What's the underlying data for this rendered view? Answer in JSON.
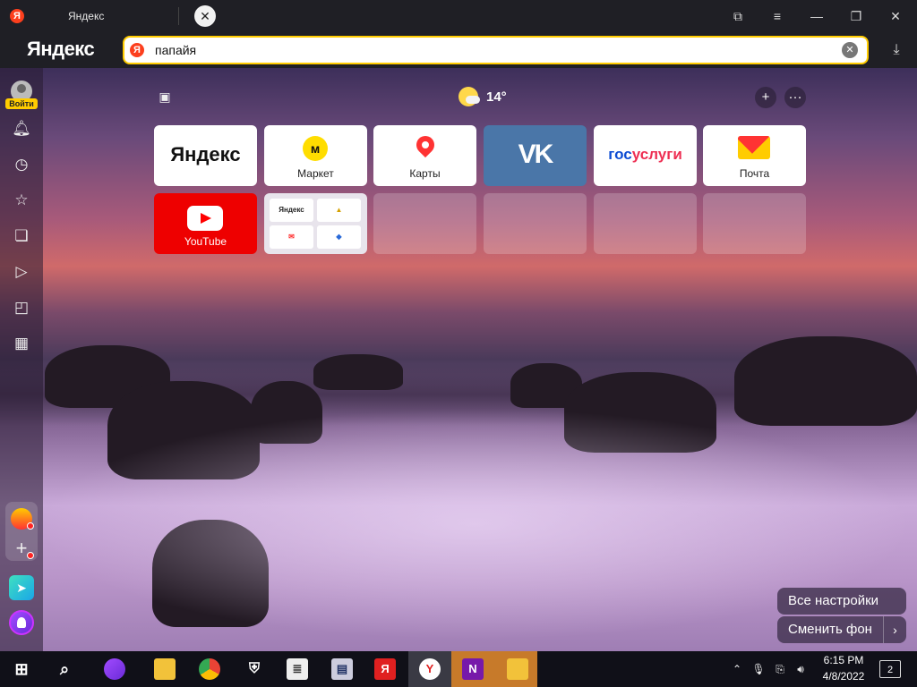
{
  "window": {
    "tab_title": "Яндекс",
    "tab_favicon": "Я",
    "close_tab_glyph": "✕",
    "collections_glyph": "⧉",
    "menu_glyph": "≡",
    "minimize_glyph": "—",
    "restore_glyph": "❐",
    "close_glyph": "✕"
  },
  "toolbar": {
    "brand": "Яндекс",
    "omnibox_icon": "Я",
    "search_value": "папайя",
    "clear_glyph": "✕",
    "download_glyph": "⤓"
  },
  "sidebar": {
    "login_label": "Войти",
    "icons": [
      {
        "name": "bell-icon",
        "glyph": "🔔︎"
      },
      {
        "name": "history-icon",
        "glyph": "◷"
      },
      {
        "name": "star-icon",
        "glyph": "☆"
      },
      {
        "name": "collections-icon",
        "glyph": "❏"
      },
      {
        "name": "play-icon",
        "glyph": "▷"
      },
      {
        "name": "camera-icon",
        "glyph": "◰"
      },
      {
        "name": "apps-grid-icon",
        "glyph": "▦"
      }
    ],
    "add_glyph": "+",
    "send_glyph": "➤"
  },
  "newtab": {
    "panel_glyph": "▣",
    "weather_temp": "14°",
    "add_glyph": "+",
    "more_glyph": "···",
    "tiles": {
      "yandex_logo": "Яндекс",
      "market_label": "Маркет",
      "market_glyph": "м",
      "maps_label": "Карты",
      "vk_text": "VK",
      "gosuslugi_left": "гос",
      "gosuslugi_right": "услуги",
      "mail_label": "Почта",
      "youtube_label": "YouTube",
      "folder_yandex": "Яндекс"
    }
  },
  "bottom_buttons": {
    "all_settings": "Все настройки",
    "change_background": "Сменить фон",
    "chevron": "›"
  },
  "taskbar": {
    "time": "6:15 PM",
    "date": "4/8/2022",
    "notifications_count": "2",
    "start_glyph": "⊞",
    "search_glyph": "⌕",
    "yandex_glyph": "Я",
    "onenote_glyph": "N"
  },
  "colors": {
    "accent_yellow": "#ffcc00",
    "yandex_red": "#fc3f1d",
    "vk_blue": "#4a76a8",
    "youtube_red": "#ee0000"
  }
}
